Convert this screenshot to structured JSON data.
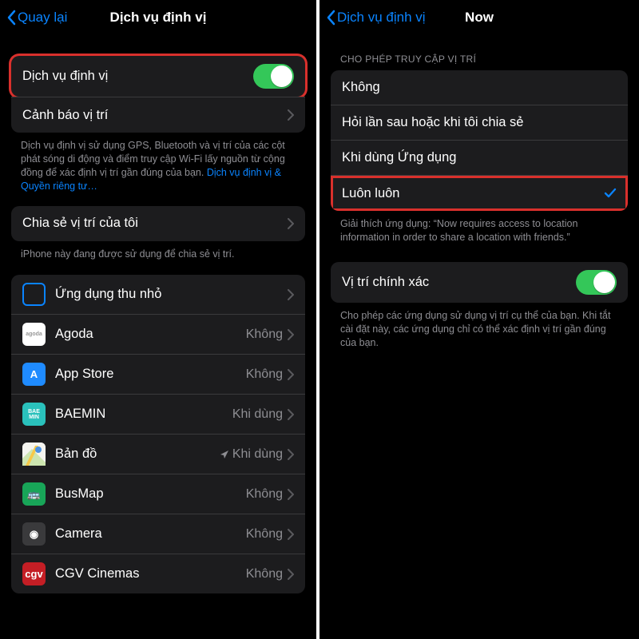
{
  "left": {
    "nav": {
      "back": "Quay lại",
      "title": "Dịch vụ định vị"
    },
    "main_toggle": {
      "label": "Dịch vụ định vị",
      "on": true
    },
    "alerts": {
      "label": "Cảnh báo vị trí"
    },
    "explain": {
      "text": "Dịch vụ định vị sử dụng GPS, Bluetooth và vị trí của các cột phát sóng di động và điểm truy cập Wi-Fi lấy nguồn từ cộng đồng để xác định vị trí gần đúng của bạn. ",
      "link": "Dịch vụ định vị & Quyền riêng tư…"
    },
    "share": {
      "label": "Chia sẻ vị trí của tôi"
    },
    "share_footer": "iPhone này đang được sử dụng để chia sẻ vị trí.",
    "apps": [
      {
        "name": "Ứng dụng thu nhỏ",
        "status": "",
        "icon_bg": "#1c1c1e",
        "icon_border": "#0a84ff"
      },
      {
        "name": "Agoda",
        "status": "Không",
        "icon_bg": "#ffffff",
        "icon_fg": "#999",
        "icon_text": "agoda"
      },
      {
        "name": "App Store",
        "status": "Không",
        "icon_bg": "#1f8bff",
        "icon_text": "A"
      },
      {
        "name": "BAEMIN",
        "status": "Khi dùng",
        "icon_bg": "#2ac1bc",
        "icon_text": "BAE\nMIN"
      },
      {
        "name": "Bản đồ",
        "status": "Khi dùng",
        "icon_bg": "#ffffff",
        "icon_text": "",
        "maps": true,
        "arrow": true
      },
      {
        "name": "BusMap",
        "status": "Không",
        "icon_bg": "#18a558",
        "icon_text": "🚌"
      },
      {
        "name": "Camera",
        "status": "Không",
        "icon_bg": "#3a3a3c",
        "icon_text": "◉"
      },
      {
        "name": "CGV Cinemas",
        "status": "Không",
        "icon_bg": "#c41e25",
        "icon_text": "cgv"
      }
    ]
  },
  "right": {
    "nav": {
      "back": "Dịch vụ định vị",
      "title": "Now"
    },
    "section_header": "CHO PHÉP TRUY CẬP VỊ TRÍ",
    "options": [
      {
        "label": "Không",
        "selected": false
      },
      {
        "label": "Hỏi lần sau hoặc khi tôi chia sẻ",
        "selected": false
      },
      {
        "label": "Khi dùng Ứng dụng",
        "selected": false
      },
      {
        "label": "Luôn luôn",
        "selected": true
      }
    ],
    "explain": "Giải thích ứng dụng: “Now requires access to location information in order to share a location with friends.”",
    "precise": {
      "label": "Vị trí chính xác",
      "on": true
    },
    "precise_footer": "Cho phép các ứng dụng sử dụng vị trí cụ thể của bạn. Khi tắt cài đặt này, các ứng dụng chỉ có thể xác định vị trí gần đúng của bạn."
  }
}
